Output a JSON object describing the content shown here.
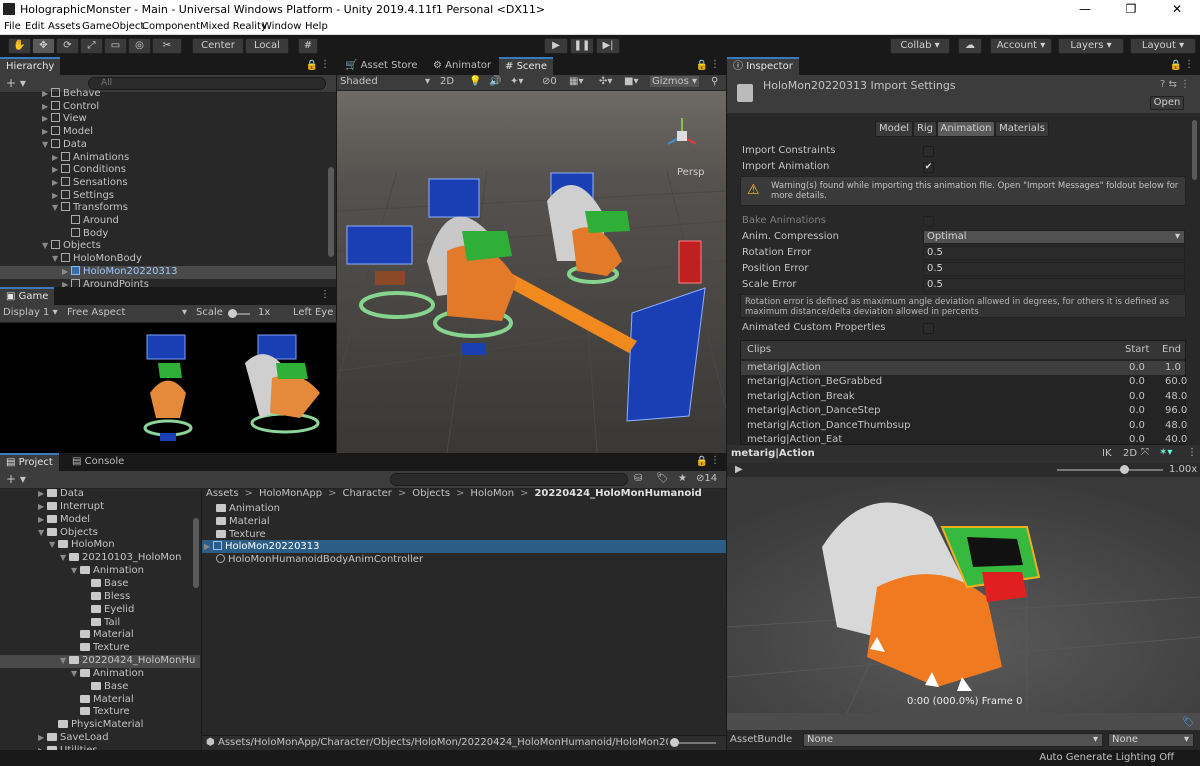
{
  "window": {
    "title": "HolographicMonster - Main - Universal Windows Platform - Unity 2019.4.11f1 Personal <DX11>",
    "min": "—",
    "max": "❐",
    "close": "✕"
  },
  "menu": [
    "File",
    "Edit",
    "Assets",
    "GameObject",
    "Component",
    "Mixed Reality",
    "Window",
    "Help"
  ],
  "toolbar": {
    "center": "Center",
    "local": "Local",
    "collab": "Collab",
    "account": "Account",
    "layers": "Layers",
    "layout": "Layout"
  },
  "hierarchy": {
    "tab": "Hierarchy",
    "search_placeholder": "All",
    "items": [
      {
        "label": "Behave",
        "d": 5,
        "a": "▶",
        "i": "cube"
      },
      {
        "label": "Control",
        "d": 5,
        "a": "▶",
        "i": "cube"
      },
      {
        "label": "View",
        "d": 5,
        "a": "▶",
        "i": "cube"
      },
      {
        "label": "Model",
        "d": 5,
        "a": "▶",
        "i": "cube"
      },
      {
        "label": "Data",
        "d": 5,
        "a": "▼",
        "i": "cube"
      },
      {
        "label": "Animations",
        "d": 6,
        "a": "▶",
        "i": "cube"
      },
      {
        "label": "Conditions",
        "d": 6,
        "a": "▶",
        "i": "cube"
      },
      {
        "label": "Sensations",
        "d": 6,
        "a": "▶",
        "i": "cube"
      },
      {
        "label": "Settings",
        "d": 6,
        "a": "▶",
        "i": "cube"
      },
      {
        "label": "Transforms",
        "d": 6,
        "a": "▼",
        "i": "cube"
      },
      {
        "label": "Around",
        "d": 7,
        "a": "",
        "i": "cube"
      },
      {
        "label": "Body",
        "d": 7,
        "a": "",
        "i": "cube"
      },
      {
        "label": "Objects",
        "d": 5,
        "a": "▼",
        "i": "cube"
      },
      {
        "label": "HoloMonBody",
        "d": 6,
        "a": "▼",
        "i": "cube"
      },
      {
        "label": "HoloMon20220313",
        "d": 7,
        "a": "▶",
        "i": "cube",
        "sel": true
      },
      {
        "label": "AroundPoints",
        "d": 7,
        "a": "▶",
        "i": "cube"
      }
    ]
  },
  "game": {
    "tab": "Game",
    "display": "Display 1",
    "aspect": "Free Aspect",
    "scale_label": "Scale",
    "scale_value": "1x",
    "eye": "Left Eye"
  },
  "scene": {
    "tabs": [
      "Asset Store",
      "Animator",
      "Scene"
    ],
    "shading": "Shaded",
    "mode2d": "2D",
    "hidden_count": "0",
    "gizmos": "Gizmos",
    "persp": "Persp"
  },
  "project": {
    "tabs": [
      "Project",
      "Console"
    ],
    "badge_count": "14",
    "breadcrumb": [
      "Assets",
      "HoloMonApp",
      "Character",
      "Objects",
      "HoloMon",
      "20220424_HoloMonHumanoid"
    ],
    "tree": [
      {
        "label": "Data",
        "d": 3,
        "a": "▶"
      },
      {
        "label": "Interrupt",
        "d": 3,
        "a": "▶"
      },
      {
        "label": "Model",
        "d": 3,
        "a": "▶"
      },
      {
        "label": "Objects",
        "d": 3,
        "a": "▼"
      },
      {
        "label": "HoloMon",
        "d": 4,
        "a": "▼"
      },
      {
        "label": "20210103_HoloMon",
        "d": 5,
        "a": "▼"
      },
      {
        "label": "Animation",
        "d": 6,
        "a": "▼"
      },
      {
        "label": "Base",
        "d": 7,
        "a": ""
      },
      {
        "label": "Bless",
        "d": 7,
        "a": ""
      },
      {
        "label": "Eyelid",
        "d": 7,
        "a": ""
      },
      {
        "label": "Tail",
        "d": 7,
        "a": ""
      },
      {
        "label": "Material",
        "d": 6,
        "a": ""
      },
      {
        "label": "Texture",
        "d": 6,
        "a": ""
      },
      {
        "label": "20220424_HoloMonHu",
        "d": 5,
        "a": "▼",
        "sel": true
      },
      {
        "label": "Animation",
        "d": 6,
        "a": "▼"
      },
      {
        "label": "Base",
        "d": 7,
        "a": ""
      },
      {
        "label": "Material",
        "d": 6,
        "a": ""
      },
      {
        "label": "Texture",
        "d": 6,
        "a": ""
      },
      {
        "label": "PhysicMaterial",
        "d": 4,
        "a": ""
      },
      {
        "label": "SaveLoad",
        "d": 3,
        "a": "▶"
      },
      {
        "label": "Utilities",
        "d": 3,
        "a": "▶"
      }
    ],
    "files": [
      {
        "label": "Animation",
        "i": "folder"
      },
      {
        "label": "Material",
        "i": "folder"
      },
      {
        "label": "Texture",
        "i": "folder"
      },
      {
        "label": "HoloMon20220313",
        "i": "model",
        "sel": true
      },
      {
        "label": "HoloMonHumanoidBodyAnimController",
        "i": "anim"
      }
    ],
    "path": "Assets/HoloMonApp/Character/Objects/HoloMon/20220424_HoloMonHumanoid/HoloMon20220"
  },
  "inspector": {
    "tab": "Inspector",
    "title": "HoloMon20220313 Import Settings",
    "open": "Open",
    "tabs": [
      "Model",
      "Rig",
      "Animation",
      "Materials"
    ],
    "import_constraints": "Import Constraints",
    "import_animation": "Import Animation",
    "warning": "Warning(s) found while importing this animation file. Open \"Import Messages\" foldout below for more details.",
    "bake": "Bake Animations",
    "compression_label": "Anim. Compression",
    "compression": "Optimal",
    "rot_label": "Rotation Error",
    "rot": "0.5",
    "pos_label": "Position Error",
    "pos": "0.5",
    "scale_label": "Scale Error",
    "scale": "0.5",
    "help": "Rotation error is defined as maximum angle deviation allowed in degrees, for others it is defined as maximum distance/delta deviation allowed in percents",
    "custom": "Animated Custom Properties",
    "clips_header": {
      "name": "Clips",
      "start": "Start",
      "end": "End"
    },
    "clips": [
      {
        "name": "metarig|Action",
        "start": "0.0",
        "end": "1.0",
        "sel": true
      },
      {
        "name": "metarig|Action_BeGrabbed",
        "start": "0.0",
        "end": "60.0"
      },
      {
        "name": "metarig|Action_Break",
        "start": "0.0",
        "end": "48.0"
      },
      {
        "name": "metarig|Action_DanceStep",
        "start": "0.0",
        "end": "96.0"
      },
      {
        "name": "metarig|Action_DanceThumbsup",
        "start": "0.0",
        "end": "48.0"
      },
      {
        "name": "metarig|Action_Eat",
        "start": "0.0",
        "end": "40.0"
      }
    ]
  },
  "preview": {
    "title": "metarig|Action",
    "ik": "IK",
    "mode2d": "2D",
    "speed": "1.00x",
    "frame": "0:00 (000.0%) Frame 0"
  },
  "assetbundle": {
    "label": "AssetBundle",
    "name": "None",
    "variant": "None"
  },
  "status": "Auto Generate Lighting Off"
}
